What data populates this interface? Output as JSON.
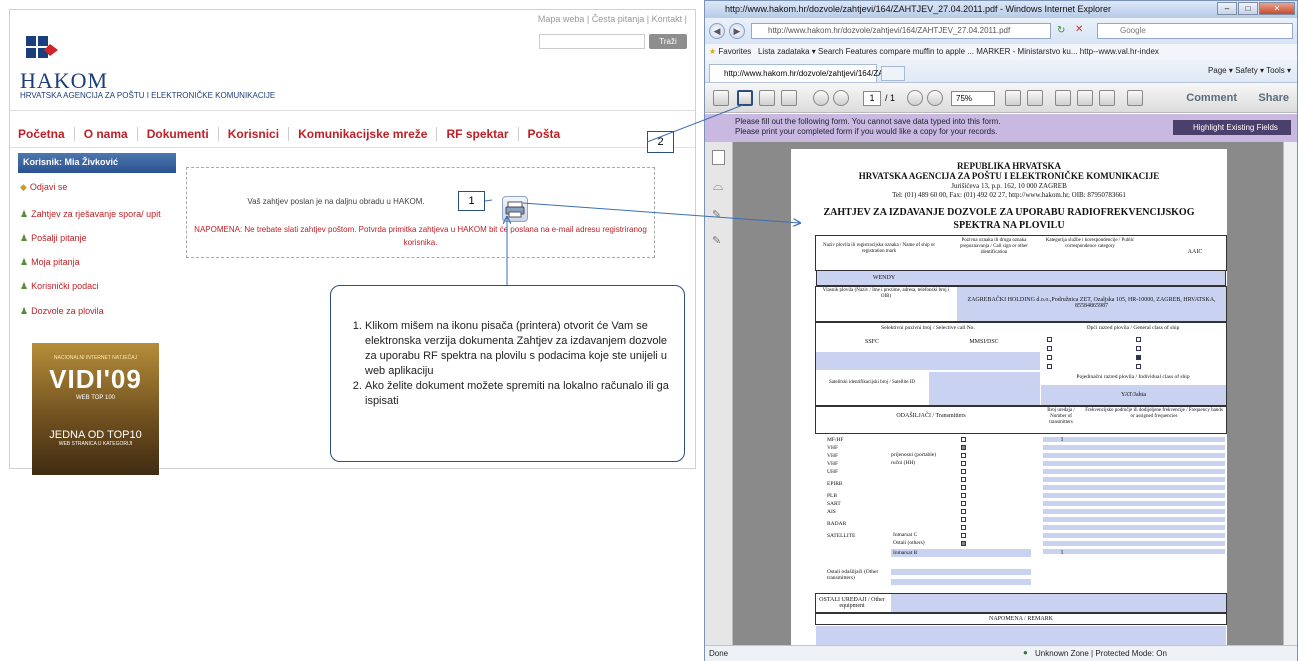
{
  "hakom": {
    "top_links": "Mapa weba | Česta pitanja | Kontakt |",
    "search_button": "Traži",
    "brand": "HAKOM",
    "brand_sub": "HRVATSKA AGENCIJA ZA POŠTU I ELEKTRONIČKE KOMUNIKACIJE",
    "nav": [
      "Početna",
      "O nama",
      "Dokumenti",
      "Korisnici",
      "Komunikacijske mreže",
      "RF spektar",
      "Pošta"
    ],
    "user_bar": "Korisnik: Mia Živković",
    "side_items": [
      {
        "label": "Odjavi se",
        "icon": "key-icon"
      },
      {
        "label": "Zahtjev za rješavanje spora/ upit",
        "icon": "people-icon"
      },
      {
        "label": "Pošalji pitanje",
        "icon": "people-icon"
      },
      {
        "label": "Moja pitanja",
        "icon": "people-icon"
      },
      {
        "label": "Korisnički podaci",
        "icon": "people-icon"
      },
      {
        "label": "Dozvole za plovila",
        "icon": "people-icon"
      }
    ],
    "message": "Vaš zahtjev poslan je na daljnu obradu u HAKOM.",
    "note": "NAPOMENA: Ne trebate slati zahtjev poštom. Potvrda primitka zahtjeva u HAKOM bit će poslana na e-mail adresu registriranog korisnika.",
    "banner": {
      "line1": "NACIONALNI INTERNET NATJEČAJ",
      "line2": "VIDI'09",
      "line3": "WEB TOP 100",
      "line4": "JEDNA OD TOP10",
      "line5": "WEB STRANICA U KATEGORIJI"
    }
  },
  "callouts": {
    "one": "1",
    "two": "2",
    "instructions": [
      "Klikom mišem na ikonu pisača (printera) otvorit će Vam se elektronska verzija dokumenta Zahtjev za izdavanjem dozvole za uporabu RF spektra na plovilu s podacima koje ste unijeli u web aplikaciju",
      "Ako želite dokument možete spremiti na lokalno računalo ili ga ispisati"
    ]
  },
  "ie": {
    "title": "http://www.hakom.hr/dozvole/zahtjevi/164/ZAHTJEV_27.04.2011.pdf - Windows Internet Explorer",
    "address": "http://www.hakom.hr/dozvole/zahtjevi/164/ZAHTJEV_27.04.2011.pdf",
    "search_placeholder": "Google",
    "favorites": "Favorites",
    "favbar_items": "Lista zadataka ▾   Search Features   compare muffin to apple ...   MARKER - Ministarstvo ku...   http--www.val.hr-index",
    "tab_label": "http://www.hakom.hr/dozvole/zahtjevi/164/ZAH...",
    "tab_tools": "Page ▾  Safety ▾  Tools ▾",
    "page_num": "1",
    "page_total": "/ 1",
    "zoom": "75%",
    "comment": "Comment",
    "share": "Share",
    "purple_line1": "Please fill out the following form. You cannot save data typed into this form.",
    "purple_line2": "Please print your completed form if you would like a copy for your records.",
    "highlight": "Highlight Existing Fields",
    "status_left": "Done",
    "status_zone": "Unknown Zone | Protected Mode: On"
  },
  "form": {
    "h1": "REPUBLIKA HRVATSKA",
    "h2": "HRVATSKA AGENCIJA ZA POŠTU I ELEKTRONIČKE KOMUNIKACIJE",
    "addr": "Jurišićeva 13, p.p. 162, 10 000 ZAGREB",
    "tel": "Tel: (01) 489 60 00, Fax: (01) 492 02 27, http://www.hakom.hr, OIB: 87950783661",
    "title1": "ZAHTJEV ZA IZDAVANJE DOZVOLE ZA UPORABU RADIOFREKVENCIJSKOG",
    "title2": "SPEKTRA NA PLOVILU",
    "col_name": "Naziv plovila ili registracijska oznaka / Name of ship or registration mark",
    "col_call": "Pozivna oznaka ili druga oznaka prepoznavanja / Call sign or other identification",
    "col_cat": "Kategorija službe i korespondencije / Public correspondence category",
    "col_aaic": "AAIC",
    "ship_name": "WENDY",
    "owner_label": "Vlasnik plovila (Naziv / Ime i prezime, adresa, telefonski broj i OIB)",
    "owner_value": "ZAGREBAČKI HOLDING d.o.o.,Podružnica ZET, Ozaljska 105, HR-10000, ZAGREB, HRVATSKA, 85584865987",
    "selective": "Selektivni pozivni broj / Selective call No.",
    "general": "Opći razred plovila / General class of ship",
    "ssfc": "SSFC",
    "mmsi": "MMSI/DSC",
    "satellite_id": "Satelitski identifikacijski broj / Satellite ID",
    "individual": "Pojedinačni razred plovila / Individual class of ship",
    "individual_value": "YAT/Jahta",
    "transmitters": "ODAŠILJAČI / Transmitters",
    "num_tx": "Broj uređaja / Number of transmitters",
    "freq": "Frekvencijsko područje ili dodijeljene frekvencije / Frequency bands or assigned frequencies",
    "rows": [
      "MF/HF",
      "VHF",
      "VHF",
      "VHF",
      "UHF",
      "EPIRB",
      "PLB",
      "SART",
      "AIS",
      "RADAR",
      "SATELLITE"
    ],
    "row_notes": [
      "prijenosni (portable)",
      "ručni (HH)",
      "Inmarsat C",
      "Ostali (others)",
      "Inmarsat B"
    ],
    "count_1": "1",
    "count_2": "1",
    "other_tx": "Ostali odašiljači (Other transmitters)",
    "other_eq": "OSTALI UREĐAJI / Other equipment",
    "remark": "NAPOMENA / REMARK"
  }
}
